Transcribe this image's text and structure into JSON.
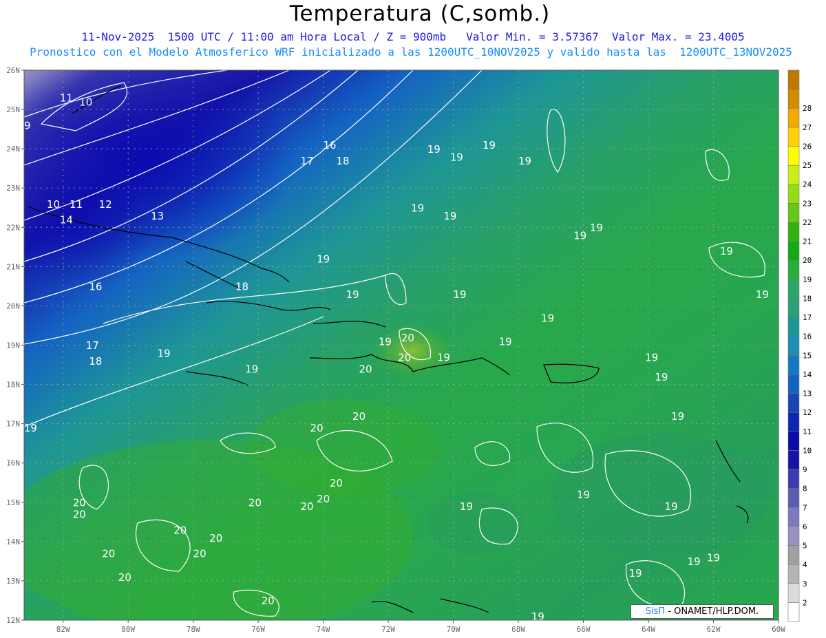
{
  "header": {
    "title": "Temperatura (C,somb.)",
    "line1": "11-Nov-2025  1500 UTC / 11:00 am Hora Local / Z = 900mb   Valor Min. = 3.57367  Valor Max. = 23.4005",
    "line2": "Pronostico con el Modelo Atmosferico WRF inicializado a las 1200UTC_10NOV2025 y valido hasta las  1200UTC_13NOV2025"
  },
  "map": {
    "lon_range": [
      -83.2,
      -60
    ],
    "lat_range": [
      12,
      26
    ],
    "lat_labels": [
      "12N",
      "13N",
      "14N",
      "15N",
      "16N",
      "17N",
      "18N",
      "19N",
      "20N",
      "21N",
      "22N",
      "23N",
      "24N",
      "25N",
      "26N"
    ],
    "lon_labels": [
      "82W",
      "80W",
      "78W",
      "76W",
      "74W",
      "72W",
      "70W",
      "68W",
      "66W",
      "64W",
      "62W",
      "60W"
    ],
    "contour_labels": [
      {
        "text": "9",
        "lon": -83.1,
        "lat": 24.5
      },
      {
        "text": "10",
        "lon": -81.3,
        "lat": 25.1
      },
      {
        "text": "11",
        "lon": -81.9,
        "lat": 25.2
      },
      {
        "text": "10",
        "lon": -82.3,
        "lat": 22.5
      },
      {
        "text": "11",
        "lon": -81.6,
        "lat": 22.5
      },
      {
        "text": "12",
        "lon": -80.7,
        "lat": 22.5
      },
      {
        "text": "13",
        "lon": -79.1,
        "lat": 22.2
      },
      {
        "text": "14",
        "lon": -81.9,
        "lat": 22.1
      },
      {
        "text": "16",
        "lon": -81.0,
        "lat": 20.4
      },
      {
        "text": "16",
        "lon": -73.8,
        "lat": 24.0
      },
      {
        "text": "17",
        "lon": -74.5,
        "lat": 23.6
      },
      {
        "text": "18",
        "lon": -73.4,
        "lat": 23.6
      },
      {
        "text": "18",
        "lon": -76.5,
        "lat": 20.4
      },
      {
        "text": "17",
        "lon": -81.1,
        "lat": 18.9
      },
      {
        "text": "18",
        "lon": -81.0,
        "lat": 18.5
      },
      {
        "text": "19",
        "lon": -78.9,
        "lat": 18.7
      },
      {
        "text": "19",
        "lon": -83.0,
        "lat": 16.8
      },
      {
        "text": "19",
        "lon": -76.2,
        "lat": 18.3
      },
      {
        "text": "19",
        "lon": -74.0,
        "lat": 21.1
      },
      {
        "text": "19",
        "lon": -73.1,
        "lat": 20.2
      },
      {
        "text": "19",
        "lon": -71.1,
        "lat": 22.4
      },
      {
        "text": "19",
        "lon": -70.1,
        "lat": 22.2
      },
      {
        "text": "19",
        "lon": -70.6,
        "lat": 23.9
      },
      {
        "text": "19",
        "lon": -69.9,
        "lat": 23.7
      },
      {
        "text": "19",
        "lon": -68.9,
        "lat": 24.0
      },
      {
        "text": "19",
        "lon": -67.8,
        "lat": 23.6
      },
      {
        "text": "19",
        "lon": -69.8,
        "lat": 20.2
      },
      {
        "text": "19",
        "lon": -68.4,
        "lat": 19.0
      },
      {
        "text": "19",
        "lon": -67.1,
        "lat": 19.6
      },
      {
        "text": "19",
        "lon": -66.1,
        "lat": 21.7
      },
      {
        "text": "19",
        "lon": -65.6,
        "lat": 21.9
      },
      {
        "text": "19",
        "lon": -61.6,
        "lat": 21.3
      },
      {
        "text": "19",
        "lon": -60.5,
        "lat": 20.2
      },
      {
        "text": "19",
        "lon": -63.9,
        "lat": 18.6
      },
      {
        "text": "19",
        "lon": -63.6,
        "lat": 18.1
      },
      {
        "text": "19",
        "lon": -63.1,
        "lat": 17.1
      },
      {
        "text": "19",
        "lon": -70.3,
        "lat": 18.6
      },
      {
        "text": "19",
        "lon": -69.6,
        "lat": 14.8
      },
      {
        "text": "19",
        "lon": -66.0,
        "lat": 15.1
      },
      {
        "text": "19",
        "lon": -63.3,
        "lat": 14.8
      },
      {
        "text": "19",
        "lon": -64.4,
        "lat": 13.1
      },
      {
        "text": "19",
        "lon": -62.6,
        "lat": 13.4
      },
      {
        "text": "19",
        "lon": -62.0,
        "lat": 13.5
      },
      {
        "text": "19",
        "lon": -67.4,
        "lat": 12.0
      },
      {
        "text": "19",
        "lon": -72.1,
        "lat": 19.0
      },
      {
        "text": "20",
        "lon": -72.7,
        "lat": 18.3
      },
      {
        "text": "20",
        "lon": -71.5,
        "lat": 18.6
      },
      {
        "text": "20",
        "lon": -71.4,
        "lat": 19.1
      },
      {
        "text": "20",
        "lon": -72.9,
        "lat": 17.1
      },
      {
        "text": "20",
        "lon": -74.2,
        "lat": 16.8
      },
      {
        "text": "20",
        "lon": -73.6,
        "lat": 15.4
      },
      {
        "text": "20",
        "lon": -74.0,
        "lat": 15.0
      },
      {
        "text": "20",
        "lon": -74.5,
        "lat": 14.8
      },
      {
        "text": "20",
        "lon": -76.1,
        "lat": 14.9
      },
      {
        "text": "20",
        "lon": -81.5,
        "lat": 14.9
      },
      {
        "text": "20",
        "lon": -81.5,
        "lat": 14.6
      },
      {
        "text": "20",
        "lon": -78.4,
        "lat": 14.2
      },
      {
        "text": "20",
        "lon": -77.3,
        "lat": 14.0
      },
      {
        "text": "20",
        "lon": -77.8,
        "lat": 13.6
      },
      {
        "text": "20",
        "lon": -80.6,
        "lat": 13.6
      },
      {
        "text": "20",
        "lon": -80.1,
        "lat": 13.0
      },
      {
        "text": "20",
        "lon": -75.7,
        "lat": 12.4
      }
    ]
  },
  "colorbar": {
    "labels": [
      "2",
      "3",
      "4",
      "5",
      "6",
      "7",
      "8",
      "9",
      "10",
      "11",
      "12",
      "13",
      "14",
      "15",
      "16",
      "17",
      "18",
      "19",
      "20",
      "21",
      "22",
      "23",
      "24",
      "25",
      "26",
      "27",
      "28"
    ],
    "colors": [
      "#ffffff",
      "#dcdcdc",
      "#b4b4b4",
      "#a0a0a0",
      "#9a92c4",
      "#7e78c0",
      "#5c5cb4",
      "#3c3cae",
      "#1414a8",
      "#0a0aa8",
      "#0a28b4",
      "#1446b4",
      "#1464c2",
      "#1478c2",
      "#1e8cb4",
      "#1e9696",
      "#28a078",
      "#28a864",
      "#28ac3c",
      "#14aa14",
      "#32b014",
      "#64c814",
      "#96dc14",
      "#c8f014",
      "#ffff00",
      "#ffd200",
      "#f0aa00",
      "#d28c00",
      "#c07800"
    ]
  },
  "credit": {
    "sis": "SisΠ",
    "rest": " - ONAMET/ΗLP.DOM."
  }
}
